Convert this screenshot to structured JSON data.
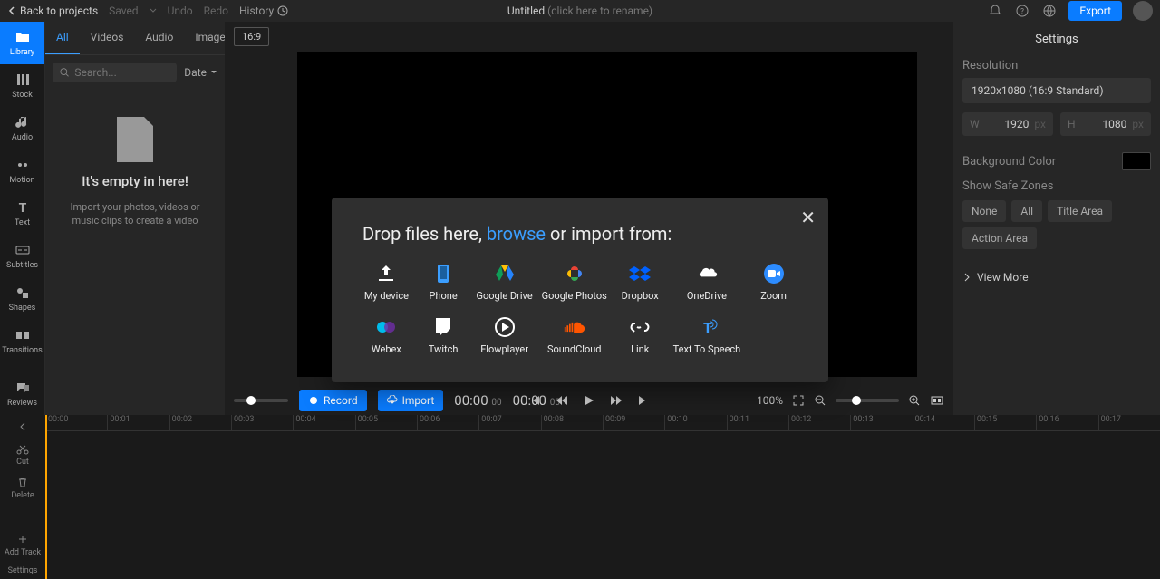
{
  "topbar": {
    "back": "Back to projects",
    "saved": "Saved",
    "undo": "Undo",
    "redo": "Redo",
    "history": "History",
    "title": "Untitled",
    "rename_hint": "(click here to rename)",
    "export": "Export"
  },
  "sidebar": {
    "items": [
      {
        "label": "Library"
      },
      {
        "label": "Stock"
      },
      {
        "label": "Audio"
      },
      {
        "label": "Motion"
      },
      {
        "label": "Text"
      },
      {
        "label": "Subtitles"
      },
      {
        "label": "Shapes"
      },
      {
        "label": "Transitions"
      }
    ],
    "reviews": "Reviews"
  },
  "library": {
    "tabs": [
      "All",
      "Videos",
      "Audio",
      "Images"
    ],
    "search_placeholder": "Search...",
    "sort": "Date",
    "empty_title": "It's empty in here!",
    "empty_text": "Import your photos, videos or music clips to create a video"
  },
  "preview": {
    "ratio": "16:9",
    "record": "Record",
    "import": "Import",
    "time1": "00:00",
    "time1_frac": "00",
    "time2": "00:00",
    "time2_frac": "00",
    "zoom": "100%"
  },
  "settings": {
    "title": "Settings",
    "resolution_label": "Resolution",
    "resolution_value": "1920x1080 (16:9 Standard)",
    "w_label": "W",
    "w_value": "1920",
    "w_unit": "px",
    "h_label": "H",
    "h_value": "1080",
    "h_unit": "px",
    "bg_label": "Background Color",
    "safe_label": "Show Safe Zones",
    "safe_opts": [
      "None",
      "All",
      "Title Area",
      "Action Area"
    ],
    "view_more": "View More"
  },
  "timeline": {
    "cut": "Cut",
    "delete": "Delete",
    "add_track": "Add Track",
    "settings": "Settings",
    "ticks": [
      "00:00",
      "00:01",
      "00:02",
      "00:03",
      "00:04",
      "00:05",
      "00:06",
      "00:07",
      "00:08",
      "00:09",
      "00:10",
      "00:11",
      "00:12",
      "00:13",
      "00:14",
      "00:15",
      "00:16",
      "00:17"
    ]
  },
  "modal": {
    "pre": "Drop files here, ",
    "browse": "browse",
    "post": " or import from:",
    "sources": [
      {
        "name": "My device",
        "icon": "upload",
        "color": "#fff"
      },
      {
        "name": "Phone",
        "icon": "phone",
        "color": "#3b9eff"
      },
      {
        "name": "Google Drive",
        "icon": "gdrive",
        "color": "#0f9d58"
      },
      {
        "name": "Google Photos",
        "icon": "gphotos",
        "color": "#ea4335"
      },
      {
        "name": "Dropbox",
        "icon": "dropbox",
        "color": "#0061ff"
      },
      {
        "name": "OneDrive",
        "icon": "onedrive",
        "color": "#fff"
      },
      {
        "name": "Zoom",
        "icon": "zoom",
        "color": "#2d8cff"
      },
      {
        "name": "Webex",
        "icon": "webex",
        "color": "#00bceb"
      },
      {
        "name": "Twitch",
        "icon": "twitch",
        "color": "#fff"
      },
      {
        "name": "Flowplayer",
        "icon": "flowplay",
        "color": "#fff"
      },
      {
        "name": "SoundCloud",
        "icon": "soundcloud",
        "color": "#ff5500"
      },
      {
        "name": "Link",
        "icon": "link",
        "color": "#fff"
      },
      {
        "name": "Text To Speech",
        "icon": "tts",
        "color": "#3b9eff"
      }
    ]
  }
}
